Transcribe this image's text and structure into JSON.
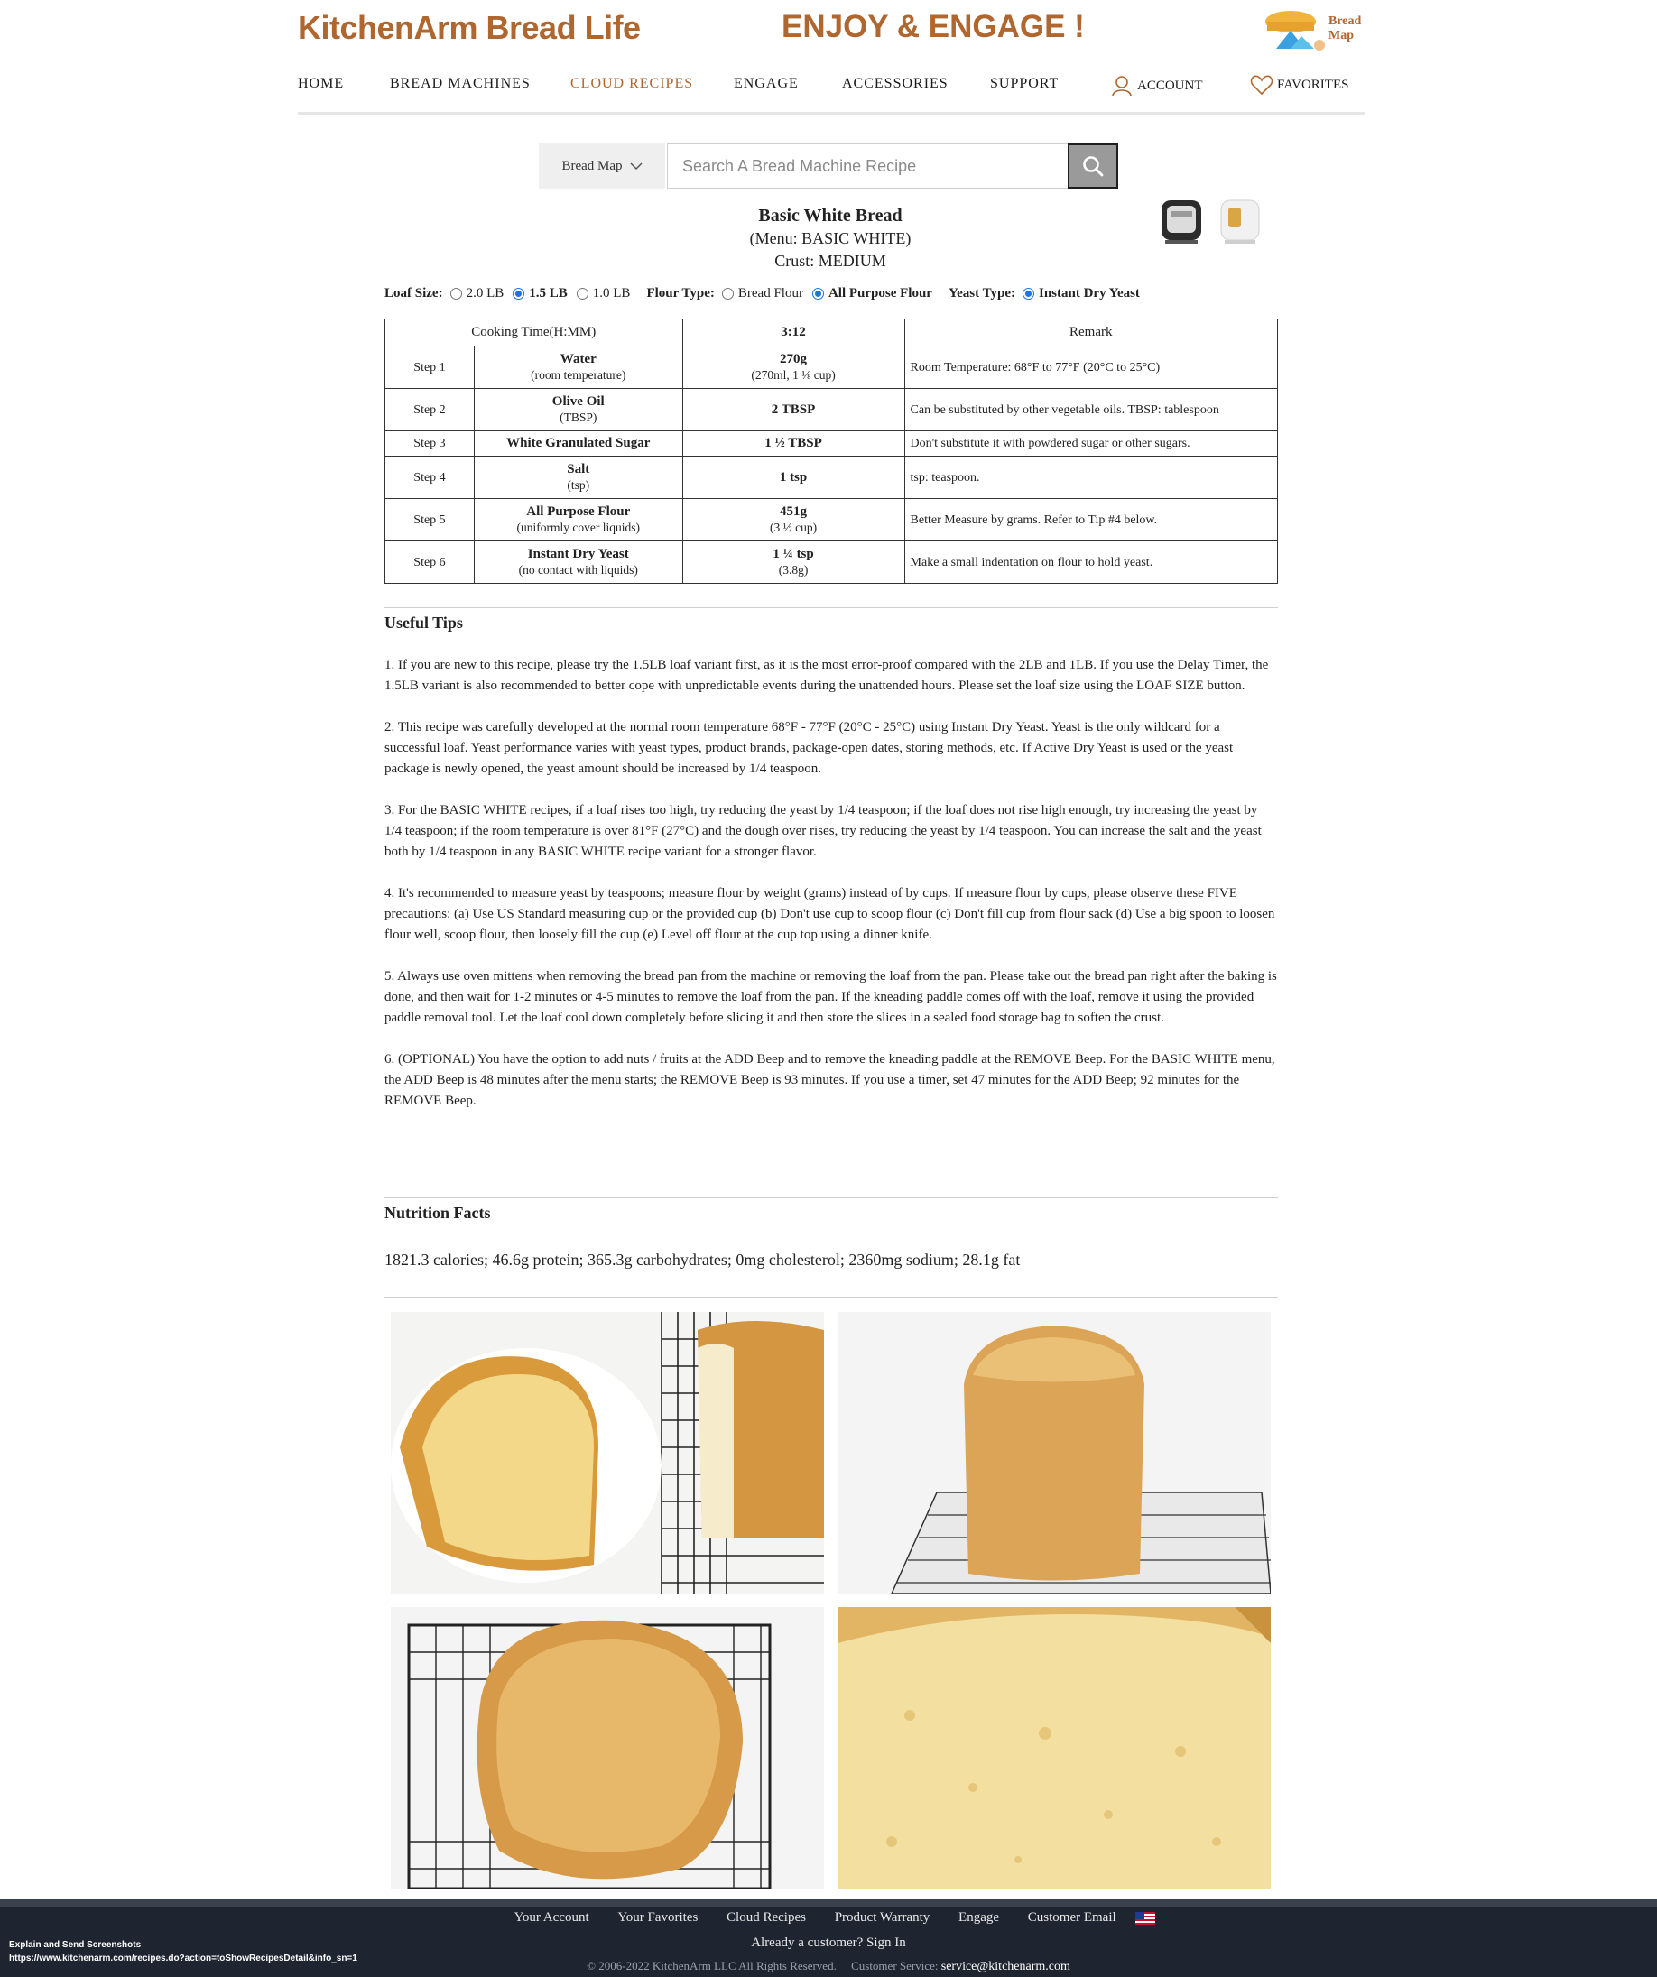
{
  "header": {
    "logo_text": "KitchenArm Bread Life",
    "slogan": "ENJOY & ENGAGE !",
    "bread_map_badge": "Bread Map",
    "nav": {
      "home": "HOME",
      "bread_machines": "BREAD MACHINES",
      "cloud_recipes": "CLOUD RECIPES",
      "engage": "ENGAGE",
      "accessories": "ACCESSORIES",
      "support": "SUPPORT",
      "account": "ACCOUNT",
      "favorites": "FAVORITES"
    },
    "active_nav": "CLOUD RECIPES",
    "accent_color": "#b0662f"
  },
  "search": {
    "select_value": "Bread Map",
    "placeholder": "Search A Bread Machine Recipe",
    "button_icon": "search-icon"
  },
  "recipe": {
    "title": "Basic White Bread",
    "menu": "(Menu: BASIC WHITE)",
    "crust": "Crust: MEDIUM"
  },
  "options": {
    "loaf_label": "Loaf Size:",
    "loaf": [
      "2.0 LB",
      "1.5 LB",
      "1.0 LB"
    ],
    "loaf_selected": "1.5 LB",
    "flour_label": "Flour Type:",
    "flour": [
      "Bread Flour",
      "All Purpose Flour"
    ],
    "flour_selected": "All Purpose Flour",
    "yeast_label": "Yeast Type:",
    "yeast": [
      "Instant Dry Yeast"
    ],
    "yeast_selected": "Instant Dry Yeast"
  },
  "table": {
    "headers": {
      "cooking_time": "Cooking Time(H:MM)",
      "time": "3:12",
      "remark": "Remark"
    },
    "rows": [
      {
        "step": "Step 1",
        "name": "Water",
        "sub": "(room temperature)",
        "amount": "270g",
        "amount_sub": "(270ml, 1 ⅛ cup)",
        "remark": "Room Temperature: 68°F to 77°F (20°C to 25°C)"
      },
      {
        "step": "Step 2",
        "name": "Olive Oil",
        "sub": "(TBSP)",
        "amount": "2 TBSP",
        "amount_sub": "",
        "remark": "Can be substituted by other vegetable oils. TBSP: tablespoon"
      },
      {
        "step": "Step 3",
        "name": "White Granulated Sugar",
        "sub": "",
        "amount": "1 ½ TBSP",
        "amount_sub": "",
        "remark": "Don't substitute it with powdered sugar or other sugars."
      },
      {
        "step": "Step 4",
        "name": "Salt",
        "sub": "(tsp)",
        "amount": "1 tsp",
        "amount_sub": "",
        "remark": "tsp: teaspoon."
      },
      {
        "step": "Step 5",
        "name": "All Purpose Flour",
        "sub": "(uniformly cover liquids)",
        "amount": "451g",
        "amount_sub": "(3 ½ cup)",
        "remark": "Better Measure by grams. Refer to Tip #4 below."
      },
      {
        "step": "Step 6",
        "name": "Instant Dry Yeast",
        "sub": "(no contact with liquids)",
        "amount": "1 ¼ tsp",
        "amount_sub": "(3.8g)",
        "remark": "Make a small indentation on flour to hold yeast."
      }
    ]
  },
  "tips": {
    "heading": "Useful Tips",
    "items": [
      "1. If you are new to this recipe, please try the 1.5LB loaf variant first, as it is the most error-proof compared with the 2LB and 1LB. If you use the Delay Timer, the 1.5LB variant is also recommended to better cope with unpredictable events during the unattended hours. Please set the loaf size using the LOAF SIZE button.",
      "2. This recipe was carefully developed at the normal room temperature 68°F - 77°F (20°C - 25°C) using Instant Dry Yeast. Yeast is the only wildcard for a successful loaf. Yeast performance varies with yeast types, product brands, package-open dates, storing methods, etc. If Active Dry Yeast is used or the yeast package is newly opened, the yeast amount should be increased by 1/4 teaspoon.",
      "3. For the BASIC WHITE recipes, if a loaf rises too high, try reducing the yeast by 1/4 teaspoon; if the loaf does not rise high enough, try increasing the yeast by 1/4 teaspoon; if the room temperature is over 81°F (27°C) and the dough over rises, try reducing the yeast by 1/4 teaspoon. You can increase the salt and the yeast both by 1/4 teaspoon in any BASIC WHITE recipe variant for a stronger flavor.",
      "4. It's recommended to measure yeast by teaspoons; measure flour by weight (grams) instead of by cups. If measure flour by cups, please observe these FIVE precautions: (a) Use US Standard measuring cup or the provided cup (b) Don't use cup to scoop flour (c) Don't fill cup from flour sack (d) Use a big spoon to loosen flour well, scoop flour, then loosely fill the cup (e) Level off flour at the cup top using a dinner knife.",
      "5. Always use oven mittens when removing the bread pan from the machine or removing the loaf from the pan. Please take out the bread pan right after the baking is done, and then wait for 1-2 minutes or 4-5 minutes to remove the loaf from the pan. If the kneading paddle comes off with the loaf, remove it using the provided paddle removal tool. Let the loaf cool down completely before slicing it and then store the slices in a sealed food storage bag to soften the crust.",
      "6. (OPTIONAL) You have the option to add nuts / fruits at the ADD Beep and to remove the kneading paddle at the REMOVE Beep. For the BASIC WHITE menu, the ADD Beep is 48 minutes after the menu starts; the REMOVE Beep is 93 minutes. If you use a timer, set 47 minutes for the ADD Beep; 92 minutes for the REMOVE Beep."
    ]
  },
  "nutrition": {
    "heading": "Nutrition Facts",
    "text": "1821.3 calories; 46.6g protein; 365.3g carbohydrates; 0mg cholesterol; 2360mg sodium; 28.1g fat"
  },
  "footer": {
    "links": [
      "Your Account",
      "Your Favorites",
      "Cloud Recipes",
      "Product Warranty",
      "Engage",
      "Customer Email"
    ],
    "signin": "Already a customer? Sign In",
    "copyright": "© 2006-2022 KitchenArm LLC All Rights Reserved.",
    "service_label": "Customer Service:",
    "service_email": "service@kitchenarm.com"
  },
  "overlay": {
    "title": "Explain and Send Screenshots",
    "url": "https://www.kitchenarm.com/recipes.do?action=toShowRecipesDetail&info_sn=1"
  }
}
